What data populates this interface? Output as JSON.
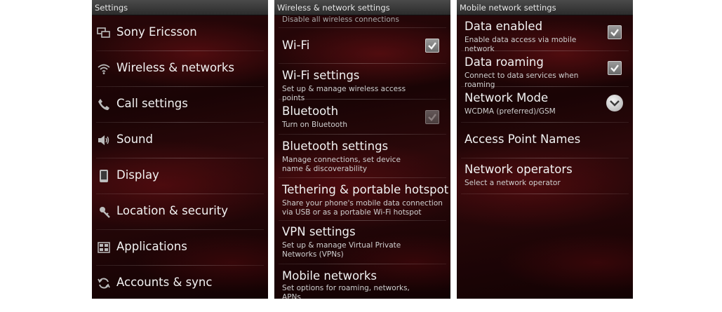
{
  "settings_panel": {
    "title": "Settings",
    "items": [
      {
        "label": "Sony Ericsson",
        "icon": "windows-icon"
      },
      {
        "label": "Wireless & networks",
        "icon": "wifi-icon"
      },
      {
        "label": "Call settings",
        "icon": "phone-icon"
      },
      {
        "label": "Sound",
        "icon": "speaker-icon"
      },
      {
        "label": "Display",
        "icon": "display-icon"
      },
      {
        "label": "Location & security",
        "icon": "location-security-icon"
      },
      {
        "label": "Applications",
        "icon": "applications-icon"
      },
      {
        "label": "Accounts & sync",
        "icon": "sync-icon"
      }
    ]
  },
  "wireless_panel": {
    "title": "Wireless & network settings",
    "partial_summary": "Disable all wireless connections",
    "items": [
      {
        "title": "Wi-Fi",
        "summary": "",
        "checked": true
      },
      {
        "title": "Wi-Fi settings",
        "summary": "Set up & manage wireless access points"
      },
      {
        "title": "Bluetooth",
        "summary": "Turn on Bluetooth",
        "checked": true,
        "enabled": false
      },
      {
        "title": "Bluetooth settings",
        "summary": "Manage connections, set device name & discoverability"
      },
      {
        "title": "Tethering & portable hotspot",
        "summary": "Share your phone's mobile data connection via USB or as a portable Wi-Fi hotspot"
      },
      {
        "title": "VPN settings",
        "summary": "Set up & manage Virtual Private Networks (VPNs)"
      },
      {
        "title": "Mobile networks",
        "summary": "Set options for roaming, networks, APNs"
      }
    ]
  },
  "mobile_panel": {
    "title": "Mobile network settings",
    "items": [
      {
        "title": "Data enabled",
        "summary": "Enable data access via mobile network",
        "checked": true
      },
      {
        "title": "Data roaming",
        "summary": "Connect to data services when roaming",
        "checked": true
      },
      {
        "title": "Network Mode",
        "summary": "WCDMA (preferred)/GSM",
        "control": "dropdown"
      },
      {
        "title": "Access Point Names",
        "summary": ""
      },
      {
        "title": "Network operators",
        "summary": "Select a network operator"
      }
    ]
  },
  "colors": {
    "title_bar": "#3a3a3a",
    "background": "#1a0405",
    "accent_red": "#7a1216",
    "text": "#f2f2f2"
  }
}
